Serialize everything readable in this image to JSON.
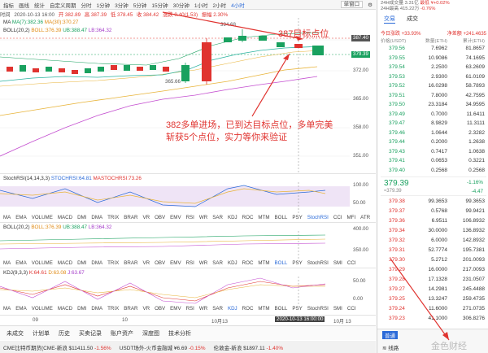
{
  "toolbar": {
    "items": [
      "指标",
      "画线",
      "统计",
      "",
      "自定义周期",
      "分时",
      "1分钟",
      "3分钟",
      "5分钟",
      "15分钟",
      "30分钟",
      "1小时",
      "2小时",
      "4小时"
    ],
    "active": "4小时",
    "select_label": "单窗口"
  },
  "info": {
    "open_label": "时间",
    "date": "2020-10-13 16:00",
    "open": "开 382.89",
    "high": "高 387.39",
    "low": "低 378.45",
    "close": "收 384.42",
    "change": "涨跌 0.40(1.53)",
    "amplitude": "振幅 2.30%"
  },
  "ma": {
    "label": "MA",
    "ma7": "MA(7):382.36",
    "ma30": "MA(30):370.27"
  },
  "boll": {
    "label": "BOLL(20,2)",
    "boll": "BOLL:376.39",
    "ub": "UB:388.47",
    "lb": "LB:364.32"
  },
  "price_axis": [
    "385.00",
    "379.39",
    "372.00",
    "365.00",
    "358.00",
    "351.00"
  ],
  "price_tags": {
    "current": "387.40",
    "last": "379.39"
  },
  "high_label": "394.68",
  "low_label": "365.66",
  "annotations": {
    "target": "387目标点位",
    "main_line1": "382多单进场，已到达目标点位，多单完美",
    "main_line2": "斩获5个点位，实力等你来验证"
  },
  "stoch": {
    "label": "StochRSI(14,14,3,3)",
    "value1": "STOCHRSI:64.81",
    "value2": "MASTOCHRSI:73.26",
    "axis": [
      "100.00",
      "50.00"
    ]
  },
  "indicator_tabs_1": [
    "MA",
    "EMA",
    "VOLUME",
    "MACD",
    "DMI",
    "DMA",
    "TRIX",
    "BRAR",
    "VR",
    "OBV",
    "EMV",
    "RSI",
    "WR",
    "SAR",
    "KDJ",
    "ROC",
    "MTM",
    "BOLL",
    "PSY",
    "StochRSI",
    "CCI",
    "MFI",
    "ATR"
  ],
  "boll2": {
    "label": "BOLL(20,2)",
    "boll": "BOLL:376.39",
    "ub": "UB:388.47",
    "lb": "LB:364.32",
    "axis": [
      "400.00",
      "350.00"
    ]
  },
  "indicator_tabs_2": [
    "MA",
    "EMA",
    "VOLUME",
    "MACD",
    "DMI",
    "DMA",
    "TRIX",
    "BRAR",
    "VR",
    "OBV",
    "EMV",
    "RSI",
    "WR",
    "SAR",
    "KDJ",
    "ROC",
    "MTM",
    "BOLL",
    "PSY",
    "StochRSI",
    "SMI",
    "CCI"
  ],
  "kdj": {
    "label": "KDJ(9,3,3)",
    "k": "K:64.61",
    "d": "D:63.08",
    "j": "J:63.67",
    "axis": [
      "50.00",
      "0.00"
    ]
  },
  "indicator_tabs_3": [
    "MA",
    "EMA",
    "VOLUME",
    "MACD",
    "DMI",
    "DMA",
    "TRIX",
    "BRAR",
    "VR",
    "OBV",
    "EMV",
    "RSI",
    "WR",
    "SAR",
    "KDJ",
    "ROC",
    "MTM",
    "BOLL",
    "PSY",
    "StochRSI",
    "SMI",
    "CCI"
  ],
  "time_axis": [
    "09",
    "10",
    "",
    "10月13",
    "",
    "16",
    "10月 13",
    "16"
  ],
  "crosshair_time": "2020-10-13 16:00:00",
  "bottom_tabs": [
    "未成交",
    "计划单",
    "历史",
    "买卖记录",
    "账户资产",
    "深度图",
    "技术分析"
  ],
  "ticker": [
    {
      "name": "CME比特币期货(CME-新浪",
      "price": "$11411.50",
      "change": "-1.56%"
    },
    {
      "name": "USDT场外-火币金融城",
      "price": "¥6.69",
      "change": "-0.15%"
    },
    {
      "name": "伦敦金-新浪",
      "price": "$1897.11",
      "change": "-1.40%"
    }
  ],
  "right_panel": {
    "top_labels": [
      "24H成交量",
      "24H最高",
      "3.31亿",
      "415.22万"
    ],
    "top_values": [
      "最低 ¥+0.02%",
      "-0.76%"
    ],
    "tabs": [
      "交易",
      "成交"
    ],
    "stats": "今日涨跌 +33.93%",
    "net": "净差额 +241.4635",
    "headers": [
      "价格(USDT)",
      "数量(ETH)",
      "累计(ETH)"
    ],
    "asks": [
      [
        "379.56",
        "7.6962",
        "81.8657"
      ],
      [
        "379.55",
        "10.9086",
        "74.1695"
      ],
      [
        "379.54",
        "2.2500",
        "63.2609"
      ],
      [
        "379.53",
        "2.9300",
        "61.0109"
      ],
      [
        "379.52",
        "16.0298",
        "58.7893"
      ],
      [
        "379.51",
        "7.8000",
        "42.7595"
      ],
      [
        "379.50",
        "23.3184",
        "34.9595"
      ],
      [
        "379.49",
        "0.7000",
        "11.6411"
      ],
      [
        "379.47",
        "8.9829",
        "11.3111"
      ],
      [
        "379.46",
        "1.0644",
        "2.3282"
      ],
      [
        "379.44",
        "0.2000",
        "1.2638"
      ],
      [
        "379.43",
        "0.7417",
        "1.0638"
      ],
      [
        "379.41",
        "0.0653",
        "0.3221"
      ],
      [
        "379.40",
        "0.2568",
        "0.2568"
      ]
    ],
    "last_price": "379.39",
    "last_cny": "≈379.39",
    "last_change": "-1.16%",
    "last_delta": "-4.47",
    "bids": [
      [
        "379.38",
        "99.3653",
        "99.3653"
      ],
      [
        "379.37",
        "0.5768",
        "99.9421"
      ],
      [
        "379.36",
        "6.9511",
        "106.8932"
      ],
      [
        "379.34",
        "30.0000",
        "136.8932"
      ],
      [
        "379.32",
        "6.0000",
        "142.8932"
      ],
      [
        "379.31",
        "52.7774",
        "195.7381"
      ],
      [
        "379.30",
        "5.2712",
        "201.0093"
      ],
      [
        "379.29",
        "16.0000",
        "217.0093"
      ],
      [
        "379.28",
        "17.1328",
        "231.0507"
      ],
      [
        "379.27",
        "14.2981",
        "245.4488"
      ],
      [
        "379.25",
        "13.3247",
        "259.4735"
      ],
      [
        "379.24",
        "11.6000",
        "271.0735"
      ],
      [
        "379.23",
        "41.1000",
        "306.8276"
      ]
    ],
    "footer_tabs": [
      "普通",
      "线路"
    ],
    "watermark": "金色财经"
  },
  "colors": {
    "up": "#e0332f",
    "down": "#19a15f",
    "accent": "#2a6ad8",
    "ma7": "#2bb3a0",
    "ma30": "#e8b43a",
    "boll_lb": "#c44fd0"
  }
}
